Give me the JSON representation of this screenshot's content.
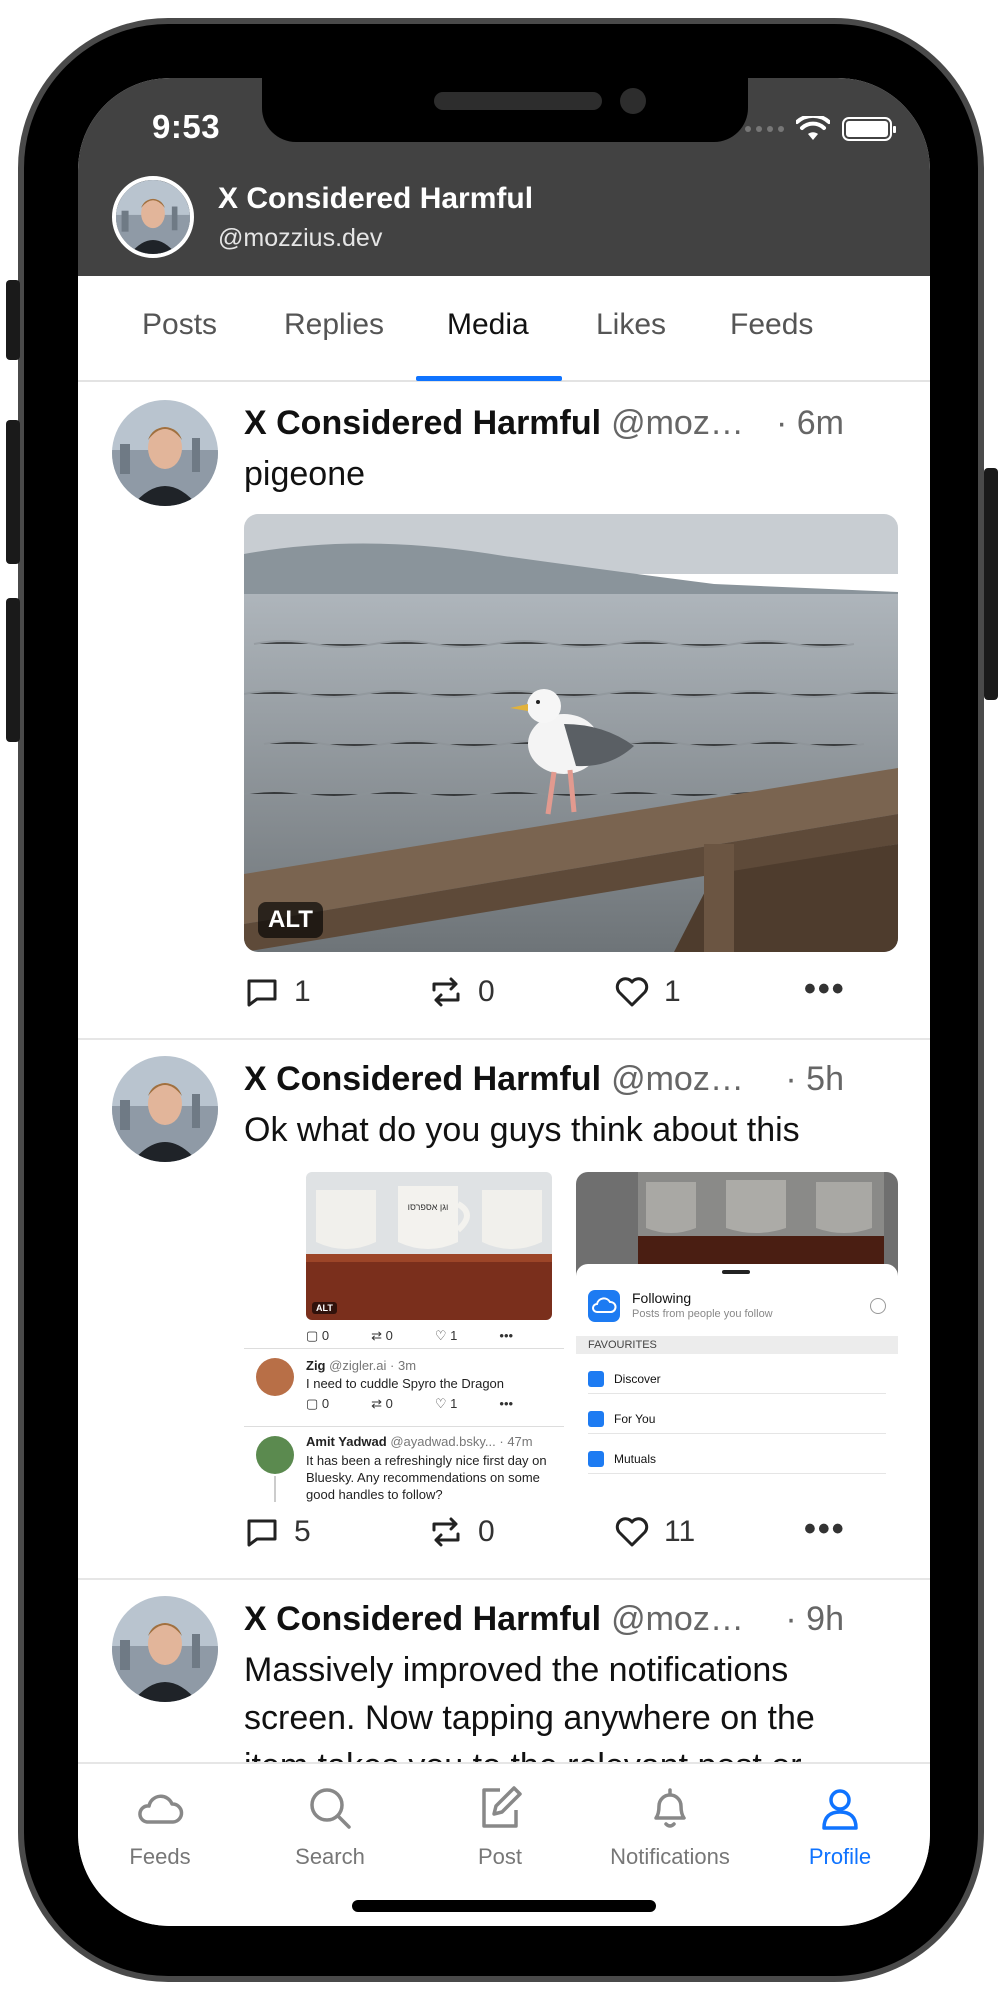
{
  "status_bar": {
    "time": "9:53"
  },
  "profile_header": {
    "name": "X Considered Harmful",
    "handle": "@mozzius.dev"
  },
  "tabs": [
    {
      "label": "Posts"
    },
    {
      "label": "Replies"
    },
    {
      "label": "Media"
    },
    {
      "label": "Likes"
    },
    {
      "label": "Feeds"
    }
  ],
  "active_tab": "Media",
  "posts": [
    {
      "name": "X Considered Harmful",
      "handle": "@moz…",
      "time": "· 6m",
      "text": "pigeone",
      "alt_badge": "ALT",
      "replies": "1",
      "reposts": "0",
      "likes": "1"
    },
    {
      "name": "X Considered Harmful",
      "handle": "@moz…",
      "time": "· 5h",
      "text": "Ok what do you guys think about this",
      "replies": "5",
      "reposts": "0",
      "likes": "11",
      "embedded_left": {
        "alt_badge": "ALT",
        "mug_text": "וגן אספרסו",
        "top_counts": {
          "replies": "0",
          "reposts": "0",
          "likes": "1"
        },
        "reply1": {
          "name": "Zig",
          "handle": "@zigler.ai",
          "time": "· 3m",
          "text": "I need to cuddle Spyro the Dragon",
          "replies": "0",
          "reposts": "0",
          "likes": "1"
        },
        "reply2": {
          "name": "Amit Yadwad",
          "handle": "@ayadwad.bsky...",
          "time": "· 47m",
          "text": "It has been a refreshingly nice first day on Bluesky. Any recommendations on some good handles to follow?"
        }
      },
      "embedded_right": {
        "following_title": "Following",
        "following_sub": "Posts from people you follow",
        "section_label": "FAVOURITES",
        "items": [
          "Discover",
          "For You",
          "Mutuals"
        ]
      }
    },
    {
      "name": "X Considered Harmful",
      "handle": "@moz…",
      "time": "· 9h",
      "text": "Massively improved the notifications screen. Now tapping anywhere on the item takes you to the relevant post or"
    }
  ],
  "bottom_nav": [
    {
      "label": "Feeds",
      "icon": "cloud-icon"
    },
    {
      "label": "Search",
      "icon": "search-icon"
    },
    {
      "label": "Post",
      "icon": "compose-icon"
    },
    {
      "label": "Notifications",
      "icon": "bell-icon"
    },
    {
      "label": "Profile",
      "icon": "person-icon"
    }
  ],
  "colors": {
    "accent": "#0f73ff",
    "header_bg": "#424242"
  }
}
